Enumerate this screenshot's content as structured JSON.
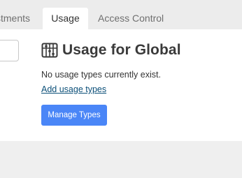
{
  "tabs": [
    {
      "label": "stments"
    },
    {
      "label": "Usage"
    },
    {
      "label": "Access Control"
    }
  ],
  "header": {
    "title": "Usage for Global",
    "icon": "abacus-icon"
  },
  "content": {
    "empty_message": "No usage types currently exist.",
    "add_link": "Add usage types",
    "manage_button": "Manage Types"
  },
  "colors": {
    "accent": "#4a86f7",
    "link": "#0b4f78"
  }
}
